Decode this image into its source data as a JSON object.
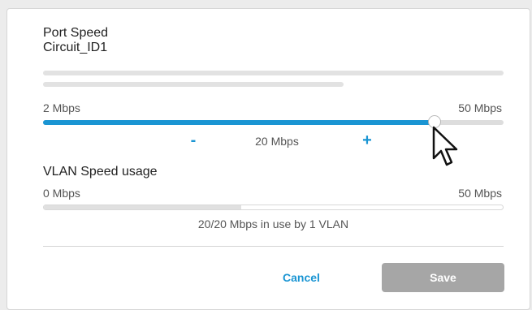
{
  "port_speed": {
    "title": "Port Speed",
    "circuit_id": "Circuit_ID1",
    "min_label": "2 Mbps",
    "max_label": "50 Mbps",
    "current_label": "20 Mbps",
    "minus_label": "-",
    "plus_label": "+",
    "slider_fraction": 0.85
  },
  "vlan_usage": {
    "title": "VLAN Speed usage",
    "min_label": "0 Mbps",
    "max_label": "50 Mbps",
    "usage_text": "20/20 Mbps in use by 1 VLAN",
    "usage_fraction": 0.43
  },
  "actions": {
    "cancel_label": "Cancel",
    "save_label": "Save"
  },
  "colors": {
    "accent": "#1a95d3",
    "save_disabled": "#a6a6a6"
  },
  "icons": {
    "cursor": "mouse-pointer-icon"
  }
}
